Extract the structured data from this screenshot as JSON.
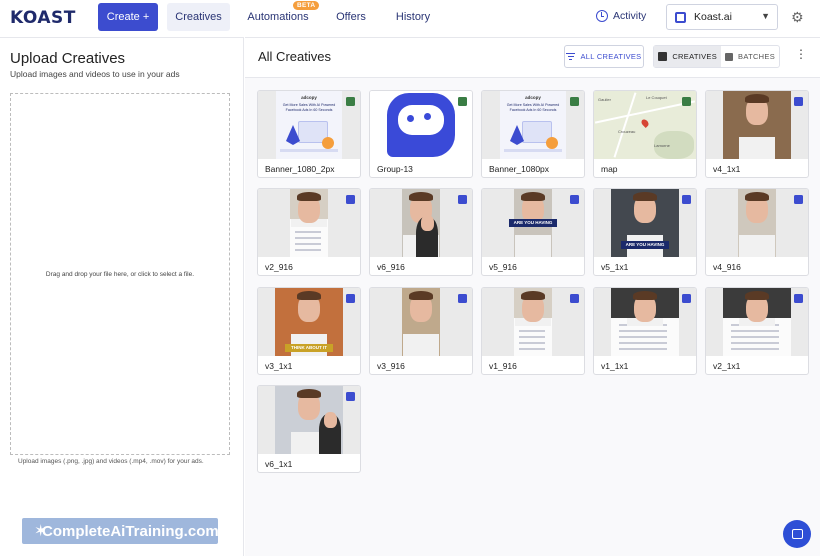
{
  "nav": {
    "logo": "KOAST",
    "create": "Create +",
    "tabs": [
      {
        "label": "Creatives",
        "active": true
      },
      {
        "label": "Automations",
        "badge": "BETA"
      },
      {
        "label": "Offers"
      },
      {
        "label": "History"
      }
    ],
    "activity": "Activity",
    "account": "Koast.ai"
  },
  "upload": {
    "title": "Upload Creatives",
    "subtitle": "Upload images and videos to use in your ads",
    "drop_text": "Drag and drop your file here, or click to select a file.",
    "hint": "Upload images (.png, .jpg) and videos (.mp4, .mov) for your ads."
  },
  "watermark": "CompleteAiTraining.com",
  "main": {
    "title": "All Creatives",
    "filter_label": "ALL CREATIVES",
    "view_creatives": "CREATIVES",
    "view_batches": "BATCHES"
  },
  "creatives": [
    {
      "name": "Banner_1080_2px",
      "type": "image",
      "kind": "banner",
      "brand": "adcopy",
      "tagline": "Get More Sales With AI Powered Facebook Ads In 60 Seconds"
    },
    {
      "name": "Group-13",
      "type": "image",
      "kind": "logo"
    },
    {
      "name": "Banner_1080px",
      "type": "image",
      "kind": "banner",
      "brand": "adcopy",
      "tagline": "Get More Sales With AI Powered Facebook Ads In 60 Seconds"
    },
    {
      "name": "map",
      "type": "image",
      "kind": "map",
      "places": [
        "Gaulier",
        "Le Couquet",
        "Crouzeau",
        "Lamorne"
      ]
    },
    {
      "name": "v4_1x1",
      "type": "video",
      "kind": "face-wide"
    },
    {
      "name": "v2_916",
      "type": "video",
      "kind": "face-ui"
    },
    {
      "name": "v6_916",
      "type": "video",
      "kind": "face-duo"
    },
    {
      "name": "v5_916",
      "type": "video",
      "kind": "face-caption",
      "caption": "ARE YOU HAVING"
    },
    {
      "name": "v5_1x1",
      "type": "video",
      "kind": "face-caption-wide",
      "caption": "ARE YOU HAVING"
    },
    {
      "name": "v4_916",
      "type": "video",
      "kind": "face"
    },
    {
      "name": "v3_1x1",
      "type": "video",
      "kind": "face-warm",
      "caption": "THINK ABOUT IT"
    },
    {
      "name": "v3_916",
      "type": "video",
      "kind": "face-warm-tall"
    },
    {
      "name": "v1_916",
      "type": "video",
      "kind": "face-ui"
    },
    {
      "name": "v1_1x1",
      "type": "video",
      "kind": "face-ui-wide"
    },
    {
      "name": "v2_1x1",
      "type": "video",
      "kind": "face-ui-wide"
    },
    {
      "name": "v6_1x1",
      "type": "video",
      "kind": "face-duo-wide"
    }
  ]
}
